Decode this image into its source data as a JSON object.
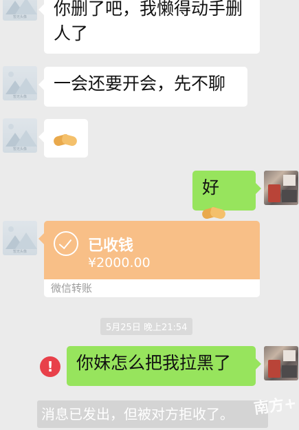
{
  "messages": [
    {
      "side": "left",
      "text": "你删了吧，我懒得动手删人了"
    },
    {
      "side": "left",
      "text": "一会还要开会，先不聊"
    },
    {
      "side": "left",
      "text": "",
      "emoji": "handshake-icon"
    },
    {
      "side": "right",
      "text": "好",
      "emoji": "handshake-icon"
    }
  ],
  "transfer": {
    "status": "已收钱",
    "amount": "¥2000.00",
    "source": "微信转账"
  },
  "timestamp": "5月25日 晚上21:54",
  "message_failed": {
    "text": "你妹怎么把我拉黑了"
  },
  "system_notice": "消息已发出，但被对方拒收了。",
  "watermark": "南方+",
  "colors": {
    "background": "#ebebeb",
    "green_bubble": "#97e45d",
    "transfer_orange": "#f8bf87",
    "error_red": "#e8404a"
  }
}
